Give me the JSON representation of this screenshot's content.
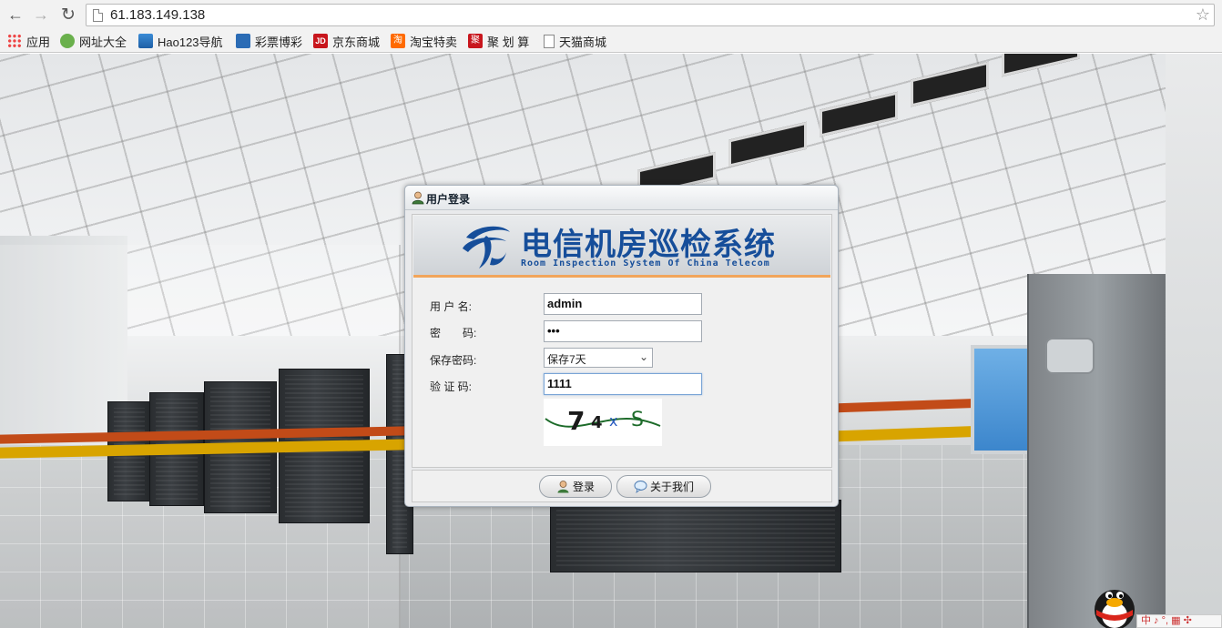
{
  "browser": {
    "url": "61.183.149.138",
    "bookmarks": [
      {
        "label": "应用",
        "icon": "apps-icon"
      },
      {
        "label": "网址大全",
        "icon": "wangzhi-icon"
      },
      {
        "label": "Hao123导航",
        "icon": "hao123-icon"
      },
      {
        "label": "彩票博彩",
        "icon": "caipiao-icon"
      },
      {
        "label": "京东商城",
        "icon": "jd-icon"
      },
      {
        "label": "淘宝特卖",
        "icon": "taobao-icon"
      },
      {
        "label": "聚 划 算",
        "icon": "juhuasuan-icon"
      },
      {
        "label": "天猫商城",
        "icon": "page-icon"
      }
    ],
    "icon_glyphs": {
      "jd": "JD",
      "taobao": "淘",
      "ju": "聚"
    }
  },
  "dialog": {
    "title": "用户登录",
    "banner_title": "电信机房巡检系统",
    "banner_subtitle": "Room Inspection System Of China Telecom",
    "form": {
      "username_label": "用 户 名:",
      "username_value": "admin",
      "password_label": "密　　码:",
      "password_value": "•••",
      "remember_label": "保存密码:",
      "remember_value": "保存7天",
      "captcha_label": "验 证 码:",
      "captcha_value": "1111",
      "captcha_text": "74xS"
    },
    "buttons": {
      "login": "登录",
      "about": "关于我们"
    }
  },
  "taskbar": {
    "ime_text": "中 ♪ °, ▦ ✣"
  },
  "colors": {
    "brand_blue": "#164e9a",
    "accent_orange": "#f2a55b"
  }
}
